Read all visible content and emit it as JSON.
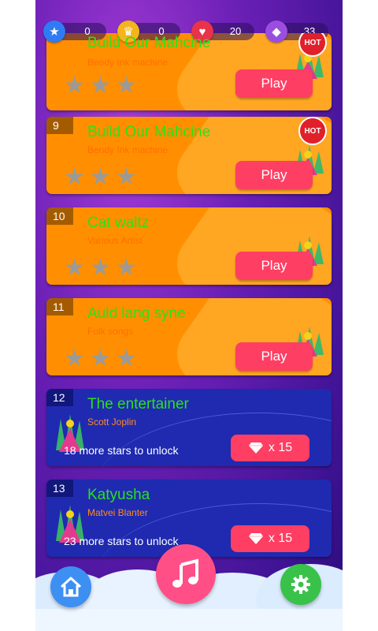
{
  "stats": [
    {
      "name": "stars",
      "value": "0",
      "color": "#2f7bf5",
      "icon": "star-icon"
    },
    {
      "name": "crowns",
      "value": "0",
      "color": "#f2b51b",
      "icon": "crown-icon"
    },
    {
      "name": "lives",
      "value": "20",
      "color": "#e8334a",
      "icon": "heart-icon"
    },
    {
      "name": "diamonds",
      "value": "33",
      "color": "#9a4ee0",
      "icon": "diamond-icon"
    }
  ],
  "songs": [
    {
      "number": "",
      "title": "Build Our Mahcine",
      "artist": "Bendy Ink machine",
      "hot": true,
      "state": "open",
      "button": "Play",
      "badge": "HOT"
    },
    {
      "number": "9",
      "title": "Build Our Mahcine",
      "artist": "Bendy Ink machine",
      "hot": true,
      "state": "open",
      "button": "Play",
      "badge": "HOT"
    },
    {
      "number": "10",
      "title": "Cat waltz",
      "artist": "Various Artist",
      "hot": false,
      "state": "open",
      "button": "Play"
    },
    {
      "number": "11",
      "title": "Auld lang syne",
      "artist": "Folk songs",
      "hot": false,
      "state": "open",
      "button": "Play"
    },
    {
      "number": "12",
      "title": "The entertainer",
      "artist": "Scott Joplin",
      "state": "locked",
      "unlock_text": "18 more stars to unlock",
      "price": "x 15"
    },
    {
      "number": "13",
      "title": "Katyusha",
      "artist": "Matvei Blanter",
      "state": "locked",
      "unlock_text": "23 more stars to unlock",
      "price": "x 15"
    }
  ],
  "nav": {
    "home_icon": "home-icon",
    "music_icon": "music-note-icon",
    "settings_icon": "gear-icon",
    "colors": {
      "home": "#3d8ff2",
      "music": "#ff4f86",
      "settings": "#39c24a"
    }
  }
}
